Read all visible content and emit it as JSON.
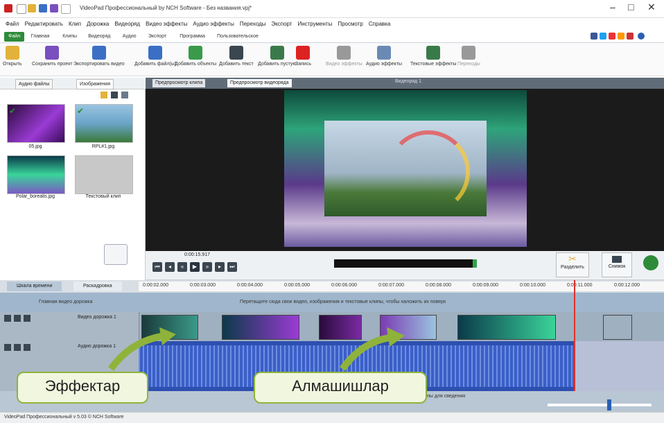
{
  "window": {
    "title": "VideoPad Профессиональный by NCH Software - Без названия.vpj*",
    "controls": [
      "–",
      "□",
      "✕"
    ]
  },
  "menu": [
    "Файл",
    "Редактировать",
    "Клип",
    "Дорожка",
    "Видеоряд",
    "Видео эффекты",
    "Аудио эффекты",
    "Переходы",
    "Экспорт",
    "Инструменты",
    "Просмотр",
    "Справка"
  ],
  "tabs": [
    "Файл",
    "Главная",
    "Клипы",
    "Видеоряд",
    "Аудио",
    "Экспорт",
    "Программа",
    "Пользовательское"
  ],
  "toolbar": [
    {
      "label": "Открыть",
      "icon": "folder-icon",
      "color": "#e2b23a"
    },
    {
      "label": "Сохранить проект",
      "icon": "save-icon",
      "color": "#7a4fbf"
    },
    {
      "label": "Экспортировать видео",
      "icon": "export-icon",
      "color": "#3a6fc4"
    },
    {
      "label": "Добавить файл(ы)",
      "icon": "add-file-icon",
      "color": "#3a6fc4"
    },
    {
      "label": "Добавить объекты",
      "icon": "add-objects-icon",
      "color": "#3a9a4a"
    },
    {
      "label": "Добавить текст",
      "icon": "text-icon",
      "color": "#3a4650"
    },
    {
      "label": "Добавить пустую",
      "icon": "blank-clip-icon",
      "color": "#3a7a4a"
    },
    {
      "label": "Запись",
      "icon": "record-icon",
      "color": "#d22"
    },
    {
      "label": "Видео эффекты",
      "icon": "video-fx-icon",
      "color": "#999"
    },
    {
      "label": "Аудио эффекты",
      "icon": "audio-fx-icon",
      "color": "#6a8ab4"
    },
    {
      "label": "Текстовые эффекты",
      "icon": "text-fx-icon",
      "color": "#3a7a4a"
    },
    {
      "label": "Переходы",
      "icon": "transition-icon",
      "color": "#999"
    }
  ],
  "media_panel": {
    "tabs": [
      "Аудио файлы",
      "Изображения"
    ],
    "items": [
      {
        "label": "05.jpg",
        "colors": [
          "#2a0b3a",
          "#9a3bd4"
        ]
      },
      {
        "label": "RPL#1.jpg",
        "colors": [
          "#6aa4c8",
          "#3a7a3a"
        ]
      },
      {
        "label": "Polar_borealis.jpg",
        "colors": [
          "#0b3a4a",
          "#3ad49a"
        ]
      },
      {
        "label": "Текстовый клип",
        "colors": [
          "#c8c8c8",
          "#c8c8c8"
        ]
      }
    ]
  },
  "preview": {
    "tabs": [
      "Предпросмотр клипа",
      "Предпросмотр видеоряда"
    ],
    "header": "Видеоряд 1",
    "time": "0:00:15.917"
  },
  "split_buttons": [
    {
      "label": "Разделить",
      "icon": "scissors-icon"
    },
    {
      "label": "Снимок",
      "icon": "camera-icon"
    }
  ],
  "timeline": {
    "tabs": [
      "Шкала времени",
      "Раскадровка"
    ],
    "ruler": [
      "0:00:02.000",
      "0:00:03.000",
      "0:00:04.000",
      "0:00:05.000",
      "0:00:06.000",
      "0:00:07.000",
      "0:00:08.000",
      "0:00:09.000",
      "0:00:10.000",
      "0:00:11.000",
      "0:00:12.000"
    ],
    "overlay_label": "Главная видео дорожка",
    "overlay_hint": "Перетащите сюда свои видео, изображения и текстовые клипы, чтобы наложить их поверх",
    "video_track": "Видео дорожка 1",
    "audio_track": "Аудио дорожка 1",
    "audio_hint": "Клипы для сведения"
  },
  "callouts": {
    "effects": "Эффектар",
    "transitions": "Алмашишлар"
  },
  "status": "VideoPad Профессиональный v 5.03 © NCH Software"
}
